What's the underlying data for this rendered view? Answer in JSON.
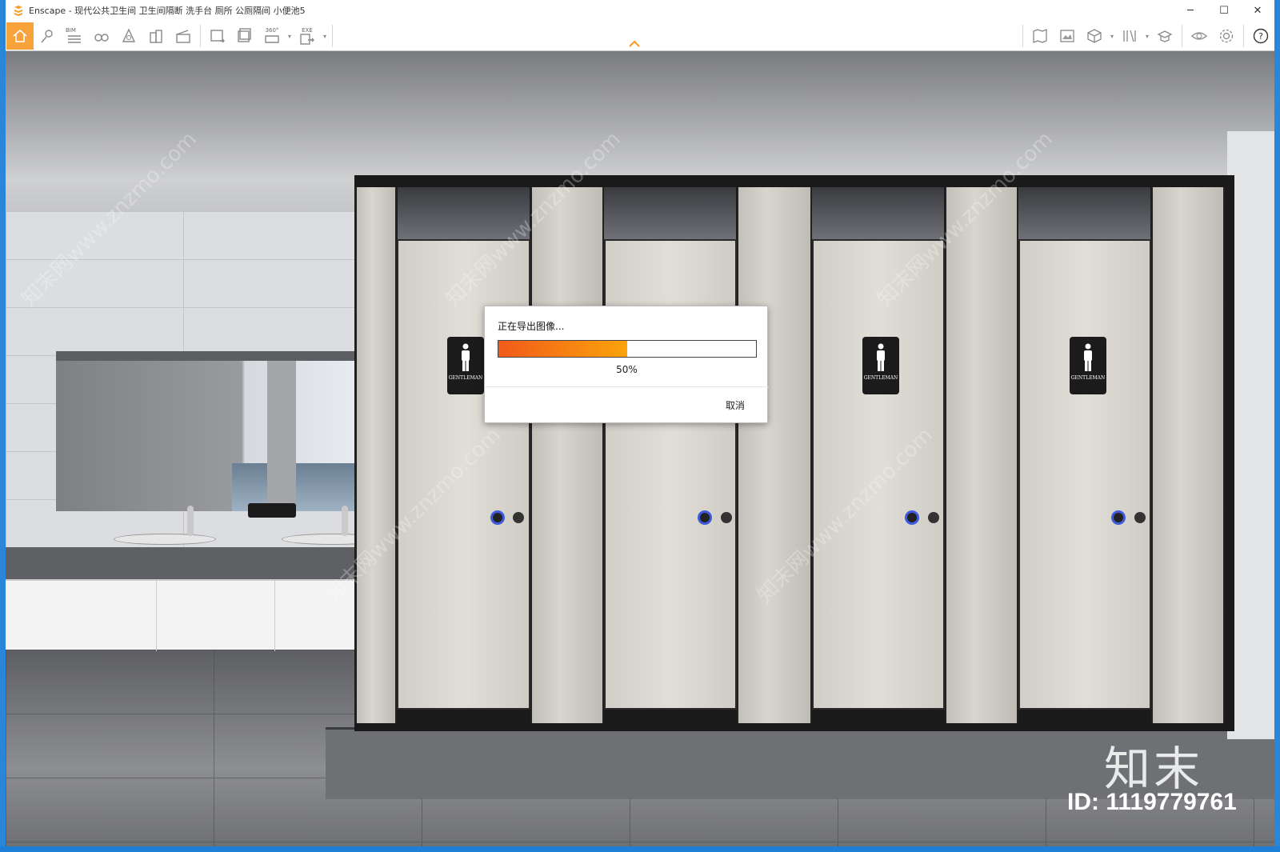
{
  "window": {
    "title": "Enscape - 现代公共卫生间 卫生间隔断 洗手台 厕所 公厕隔间 小便池5",
    "controls": [
      "minimize",
      "maximize",
      "close"
    ]
  },
  "toolbar": {
    "left_tools": [
      "home-icon",
      "location-pin-icon",
      "bim-icon",
      "binoculars-icon",
      "light-icon",
      "buildings-icon",
      "clapper-icon",
      "screenshot-icon",
      "batch-render-icon",
      "panorama-360-icon",
      "export-exe-icon"
    ],
    "bim_label": "BIM",
    "pano_label": "360°",
    "exe_label": "EXE",
    "right_tools": [
      "map-icon",
      "gallery-icon",
      "cube-icon",
      "library-icon",
      "hat-icon",
      "eye-icon",
      "settings-icon",
      "help-icon"
    ],
    "accent": "#f7a23a"
  },
  "scene": {
    "sign_label": "GENTLEMAN",
    "watermark_text": "知末网www.znzmo.com",
    "brand_logo": "知末",
    "brand_id": "ID: 1119779761"
  },
  "dialog": {
    "title": "正在导出图像...",
    "progress": 0.5,
    "progress_label": "50%",
    "cancel_label": "取消",
    "progress_colors": [
      "#f05a1a",
      "#fba40b"
    ]
  }
}
